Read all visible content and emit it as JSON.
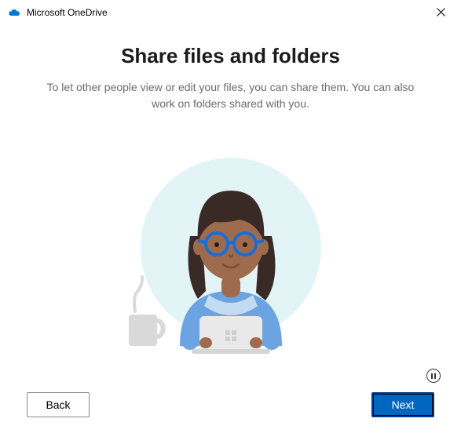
{
  "titlebar": {
    "app_name": "Microsoft OneDrive"
  },
  "main": {
    "title": "Share files and folders",
    "description": "To let other people view or edit your files, you can share them. You can also work on folders shared with you."
  },
  "buttons": {
    "back": "Back",
    "next": "Next"
  },
  "colors": {
    "primary": "#0067c0",
    "bg_circle": "#e2f4f6",
    "shirt": "#6ba4e0",
    "collar": "#c4dcf2",
    "skin": "#9f6b4e",
    "hair": "#3a2a26",
    "glasses": "#1a6dd6",
    "laptop": "#e9e9e9",
    "mug": "#d5d5d5"
  }
}
